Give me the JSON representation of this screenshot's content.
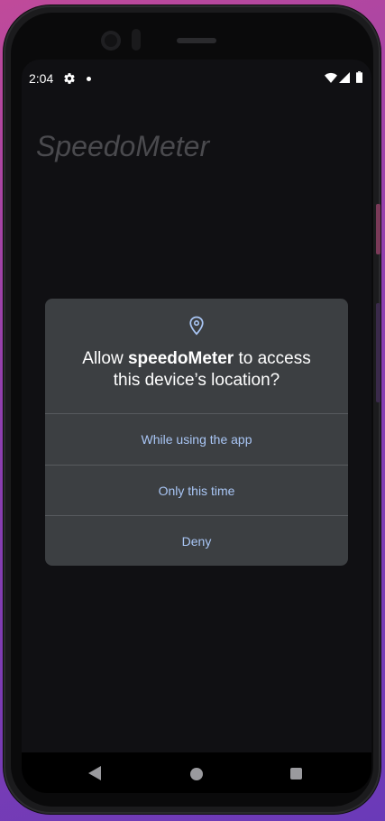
{
  "status_bar": {
    "time": "2:04",
    "icons": [
      "gear-icon",
      "notification-dot-icon",
      "wifi-icon",
      "cell-signal-icon",
      "battery-icon"
    ]
  },
  "app": {
    "title": "SpeedoMeter"
  },
  "permission_dialog": {
    "icon": "location-pin-icon",
    "title_prefix": "Allow ",
    "app_name": "speedoMeter",
    "title_suffix_line1": " to access",
    "title_line2": "this device’s location?",
    "options": [
      {
        "label": "While using the app"
      },
      {
        "label": "Only this time"
      },
      {
        "label": "Deny"
      }
    ]
  },
  "nav_bar": {
    "icons": [
      "back-icon",
      "home-icon",
      "recents-icon"
    ]
  },
  "colors": {
    "dialog_background": "#3c3f42",
    "option_text": "#a9c6f5",
    "screen_background": "#101013",
    "wallpaper_gradient_start": "#c04a9a",
    "wallpaper_gradient_end": "#6a3ab8"
  }
}
